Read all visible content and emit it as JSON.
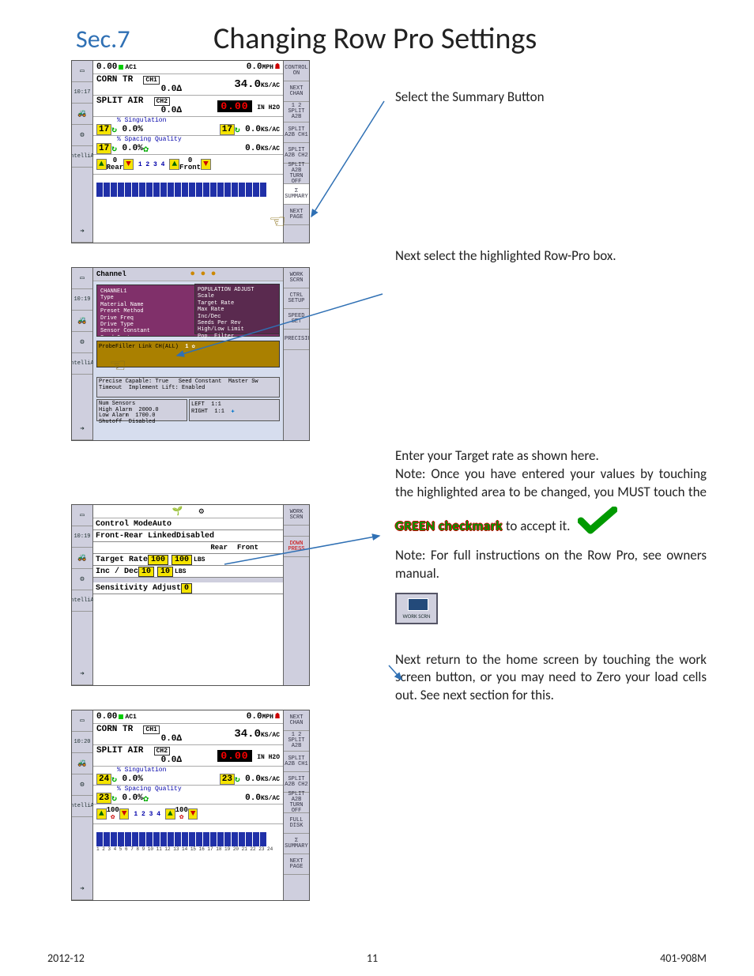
{
  "header": {
    "section": "Sec.7",
    "title": "Changing Row Pro Settings"
  },
  "instructions": {
    "step1": "Select the Summary Button",
    "step2": "Next select the highlighted Row-Pro box.",
    "step3_line1": "Enter your Target rate as shown here.",
    "step3_line2": "Note: Once you have entered your values by touching the highlighted area to be changed, you MUST touch the ",
    "step3_green": "GREEN checkmark",
    "step3_line2_end": " to accept it.",
    "step3_note": "Note:  For full instructions on the Row Pro, see owners manual.",
    "step4": "Next return to the home screen by touching the work screen button, or you may need to Zero your load cells out.  See next section for this.",
    "work_btn_label": "WORK  SCRN"
  },
  "screen1": {
    "time": "10:17",
    "speed_val": "0.00",
    "speed_unit": "AC1",
    "mph_val": "0.0",
    "mph_unit": "MPH",
    "corn_label": "CORN TR",
    "corn_ch": "CH1",
    "corn_delta": "0.0Δ",
    "corn_rate": "34.0",
    "corn_rate_unit": "KS/AC",
    "split_label": "SPLIT AIR",
    "split_ch": "CH2",
    "split_delta": "0.0Δ",
    "split_rate": "0.00",
    "split_rate_unit": "IN H2O",
    "sing_label": "% Singulation",
    "sing_l": "17",
    "sing_pct": "0.0%",
    "sing_r": "17",
    "sing_rate": "0.0",
    "sing_unit": "KS/AC",
    "sq_label": "% Spacing Quality",
    "sq_l": "17",
    "sq_pct": "0.0%",
    "sq_rate": "0.0",
    "sq_unit": "KS/AC",
    "rear_lbl": "Rear",
    "rear_val": "0",
    "front_lbl": "Front",
    "front_val": "0",
    "seq": "1  2  3  4",
    "rhs": [
      "CONTROL ON",
      "NEXT CHAN",
      "1 2  SPLIT A2B",
      "SPLIT A2B CH1",
      "SPLIT A2B CH2",
      "SPLIT A2B TURN OFF",
      "Σ SUMMARY",
      "NEXT PAGE"
    ]
  },
  "screen2": {
    "time": "10:19",
    "channel_label": "Channel",
    "rhs": [
      "WORK SCRN",
      "CTRL SETUP",
      "SPEED SET",
      "PRECISION"
    ]
  },
  "screen3": {
    "time": "10:19",
    "cm_label": "Control Mode",
    "cm_val": "Auto",
    "fr_label": "Front-Rear Linked",
    "fr_val": "Disabled",
    "col_rear": "Rear",
    "col_front": "Front",
    "tr_label": "Target Rate",
    "tr_rear": "100",
    "tr_front": "100",
    "tr_unit": "LBS",
    "id_label": "Inc / Dec",
    "id_rear": "10",
    "id_front": "10",
    "id_unit": "LBS",
    "sens_label": "Sensitivity Adjust",
    "sens_val": "0",
    "rhs": [
      "WORK SCRN",
      "DOWN PRESS"
    ]
  },
  "screen4": {
    "time": "10:20",
    "speed_val": "0.00",
    "speed_unit": "AC1",
    "mph_val": "0.0",
    "mph_unit": "MPH",
    "corn_label": "CORN TR",
    "corn_ch": "CH1",
    "corn_delta": "0.0Δ",
    "corn_rate": "34.0",
    "corn_rate_unit": "KS/AC",
    "split_label": "SPLIT AIR",
    "split_ch": "CH2",
    "split_delta": "0.0Δ",
    "split_rate": "0.00",
    "split_rate_unit": "IN H2O",
    "sing_label": "% Singulation",
    "sing_l": "24",
    "sing_pct": "0.0%",
    "sing_r": "23",
    "sing_rate": "0.0",
    "sing_unit": "KS/AC",
    "sq_label": "% Spacing Quality",
    "sq_l": "23",
    "sq_pct": "0.0%",
    "sq_rate": "0.0",
    "sq_unit": "KS/AC",
    "rear_val": "100",
    "front_val": "100",
    "seq": "1  2  3  4",
    "rhs": [
      "NEXT CHAN",
      "1 2  SPLIT A2B",
      "SPLIT A2B CH1",
      "SPLIT A2B CH2",
      "SPLIT A2B TURN OFF",
      "FULL DISK",
      "Σ SUMMARY",
      "NEXT PAGE"
    ]
  },
  "footer": {
    "date": "2012-12",
    "page": "11",
    "doc": "401-908M"
  }
}
